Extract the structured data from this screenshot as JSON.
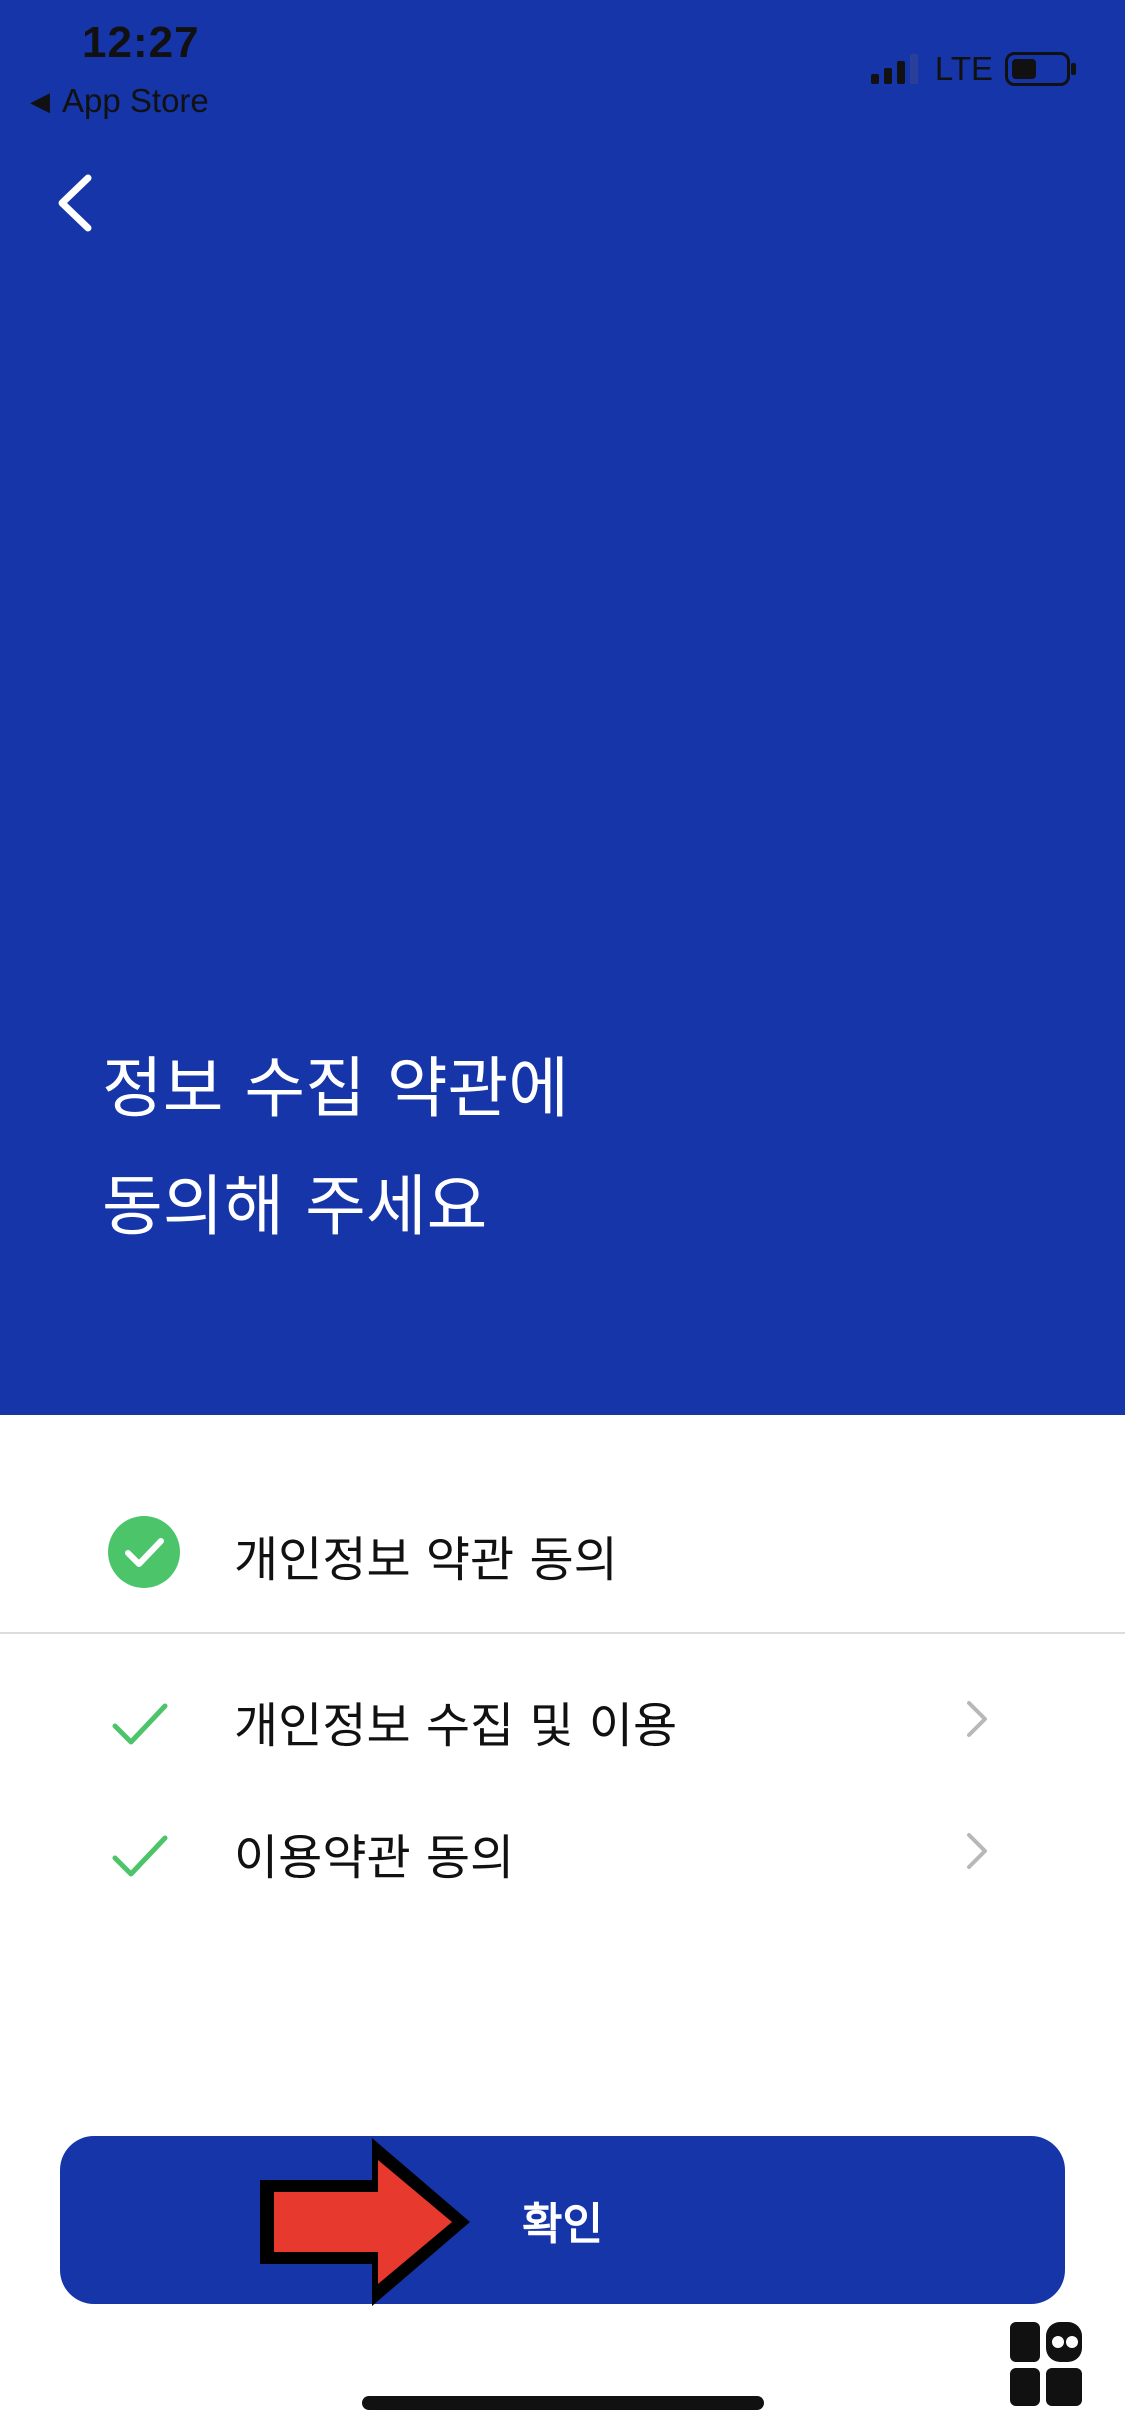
{
  "status_bar": {
    "time": "12:27",
    "back_app": "App Store",
    "network": "LTE",
    "icons": [
      "signal-icon",
      "battery-icon"
    ]
  },
  "nav": {
    "back_icon": "chevron-left-icon"
  },
  "hero": {
    "title_line1": "정보 수집 약관에",
    "title_line2": "동의해 주세요"
  },
  "agreements": {
    "all": {
      "label": "개인정보 약관 동의",
      "checked": true
    },
    "items": [
      {
        "label": "개인정보 수집 및 이용",
        "checked": true
      },
      {
        "label": "이용약관 동의",
        "checked": true
      }
    ]
  },
  "confirm_button": {
    "label": "확인"
  },
  "colors": {
    "primary": "#1535a8",
    "check_green": "#4cc46a",
    "chevron": "#b8b8b8",
    "annotation_arrow": "#e8392f"
  }
}
